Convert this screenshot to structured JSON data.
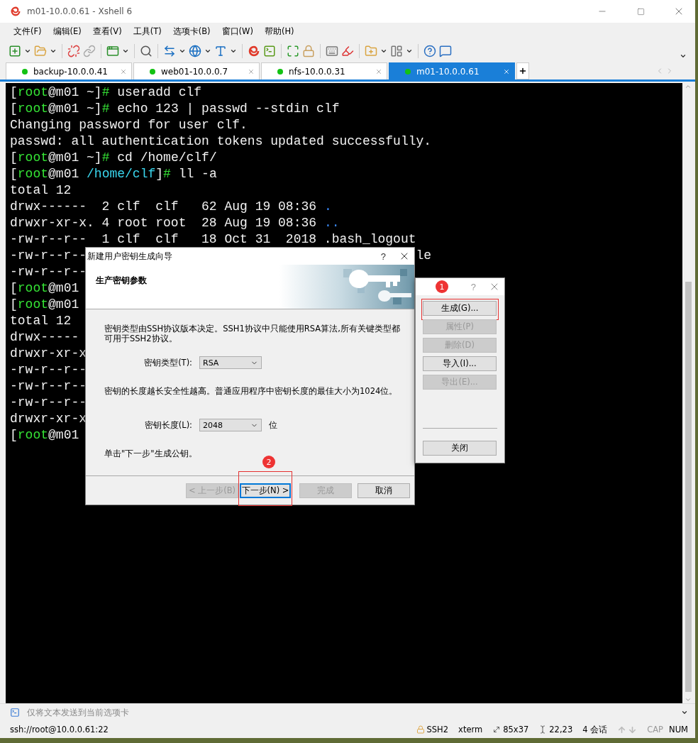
{
  "window": {
    "title": "m01-10.0.0.61 - Xshell 6"
  },
  "menu": [
    "文件(F)",
    "编辑(E)",
    "查看(V)",
    "工具(T)",
    "选项卡(B)",
    "窗口(W)",
    "帮助(H)"
  ],
  "tabs": [
    {
      "label": "backup-10.0.0.41",
      "selected": false,
      "connected": true
    },
    {
      "label": "web01-10.0.0.7",
      "selected": false,
      "connected": true
    },
    {
      "label": "nfs-10.0.0.31",
      "selected": false,
      "connected": true
    },
    {
      "label": "m01-10.0.0.61",
      "selected": true,
      "connected": true
    }
  ],
  "terminal": {
    "lines": [
      {
        "segments": [
          {
            "text": "[",
            "kind": "plain"
          },
          {
            "text": "root",
            "kind": "user"
          },
          {
            "text": "@m01 ~]",
            "kind": "plain"
          },
          {
            "text": "#",
            "kind": "user"
          },
          {
            "text": " useradd clf",
            "kind": "plain"
          }
        ]
      },
      {
        "segments": [
          {
            "text": "[",
            "kind": "plain"
          },
          {
            "text": "root",
            "kind": "user"
          },
          {
            "text": "@m01 ~]",
            "kind": "plain"
          },
          {
            "text": "#",
            "kind": "user"
          },
          {
            "text": " echo 123 | passwd --stdin clf",
            "kind": "plain"
          }
        ]
      },
      {
        "segments": [
          {
            "text": "Changing password for user clf.",
            "kind": "plain"
          }
        ]
      },
      {
        "segments": [
          {
            "text": "passwd: all authentication tokens updated successfully.",
            "kind": "plain"
          }
        ]
      },
      {
        "segments": [
          {
            "text": "[",
            "kind": "plain"
          },
          {
            "text": "root",
            "kind": "user"
          },
          {
            "text": "@m01 ~]",
            "kind": "plain"
          },
          {
            "text": "#",
            "kind": "user"
          },
          {
            "text": " cd /home/clf/",
            "kind": "plain"
          }
        ]
      },
      {
        "segments": [
          {
            "text": "[",
            "kind": "plain"
          },
          {
            "text": "root",
            "kind": "user"
          },
          {
            "text": "@m01 ",
            "kind": "plain"
          },
          {
            "text": "/home/clf",
            "kind": "path"
          },
          {
            "text": "]",
            "kind": "plain"
          },
          {
            "text": "#",
            "kind": "user"
          },
          {
            "text": " ll -a",
            "kind": "plain"
          }
        ]
      },
      {
        "segments": [
          {
            "text": "total 12",
            "kind": "plain"
          }
        ]
      },
      {
        "segments": [
          {
            "text": "drwx------  2 clf  clf   62 Aug 19 08:36 ",
            "kind": "plain"
          },
          {
            "text": ".",
            "kind": "dir"
          }
        ]
      },
      {
        "segments": [
          {
            "text": "drwxr-xr-x. 4 root root  28 Aug 19 08:36 ",
            "kind": "plain"
          },
          {
            "text": "..",
            "kind": "dir"
          }
        ]
      },
      {
        "segments": [
          {
            "text": "-rw-r--r--  1 clf  clf   18 Oct 31  2018 .bash_logout",
            "kind": "plain"
          }
        ]
      },
      {
        "segments": [
          {
            "text": "-rw-r--r--",
            "kind": "plain"
          }
        ],
        "tail": "le"
      },
      {
        "segments": [
          {
            "text": "-rw-r--r--",
            "kind": "plain"
          }
        ]
      },
      {
        "segments": [
          {
            "text": "[",
            "kind": "plain"
          },
          {
            "text": "root",
            "kind": "user"
          },
          {
            "text": "@m01",
            "kind": "plain"
          }
        ]
      },
      {
        "segments": [
          {
            "text": "[",
            "kind": "plain"
          },
          {
            "text": "root",
            "kind": "user"
          },
          {
            "text": "@m01",
            "kind": "plain"
          }
        ]
      },
      {
        "segments": [
          {
            "text": "total 12",
            "kind": "plain"
          }
        ]
      },
      {
        "segments": [
          {
            "text": "drwx-----",
            "kind": "plain"
          }
        ]
      },
      {
        "segments": [
          {
            "text": "drwxr-xr-x",
            "kind": "plain"
          }
        ]
      },
      {
        "segments": [
          {
            "text": "-rw-r--r--",
            "kind": "plain"
          }
        ]
      },
      {
        "segments": [
          {
            "text": "-rw-r--r--",
            "kind": "plain"
          }
        ]
      },
      {
        "segments": [
          {
            "text": "-rw-r--r--",
            "kind": "plain"
          }
        ]
      },
      {
        "segments": [
          {
            "text": "drwxr-xr-x",
            "kind": "plain"
          }
        ]
      },
      {
        "segments": [
          {
            "text": "[",
            "kind": "plain"
          },
          {
            "text": "root",
            "kind": "user"
          },
          {
            "text": "@m01",
            "kind": "plain"
          }
        ]
      }
    ]
  },
  "wizard": {
    "title": "新建用户密钥生成向导",
    "help": "?",
    "heading": "生产密钥参数",
    "intro": "密钥类型由SSH协议版本决定。SSH1协议中只能使用RSA算法,所有关键类型都可用于SSH2协议。",
    "type_field": {
      "label": "密钥类型(T):",
      "value": "RSA"
    },
    "length_note": "密钥的长度越长安全性越高。普通应用程序中密钥长度的最佳大小为1024位。",
    "length_field": {
      "label": "密钥长度(L):",
      "value": "2048",
      "unit": "位"
    },
    "hint": "单击\"下一步\"生成公钥。",
    "badge": "2",
    "buttons": [
      {
        "label": "< 上一步(B)",
        "disabled": true,
        "focused": false,
        "highlighted": false
      },
      {
        "label": "下一步(N) >",
        "disabled": false,
        "focused": true,
        "highlighted": true
      },
      {
        "label": "完成",
        "disabled": true,
        "focused": false,
        "highlighted": false
      },
      {
        "label": "取消",
        "disabled": false,
        "focused": false,
        "highlighted": false
      }
    ]
  },
  "key_dialog": {
    "badge": "1",
    "help": "?",
    "buttons": [
      {
        "label": "生成(G)...",
        "disabled": false,
        "highlighted": true
      },
      {
        "label": "属性(P)",
        "disabled": true,
        "highlighted": false
      },
      {
        "label": "删除(D)",
        "disabled": true,
        "highlighted": false
      },
      {
        "label": "导入(I)...",
        "disabled": false,
        "highlighted": false
      },
      {
        "label": "导出(E)...",
        "disabled": true,
        "highlighted": false
      }
    ],
    "close_button": "关闭"
  },
  "send_bar": {
    "placeholder": "仅将文本发送到当前选项卡"
  },
  "status_bar": {
    "address": "ssh://root@10.0.0.61:22",
    "items": [
      {
        "text": "SSH2",
        "kind": "lock"
      },
      {
        "text": "xterm",
        "kind": "plain"
      },
      {
        "text": "85x37",
        "kind": "size"
      },
      {
        "text": "22,23",
        "kind": "cursor"
      },
      {
        "text": "4 会话",
        "kind": "plain"
      }
    ],
    "keys": [
      {
        "text": "CAP",
        "on": false
      },
      {
        "text": "NUM",
        "on": true
      }
    ]
  }
}
